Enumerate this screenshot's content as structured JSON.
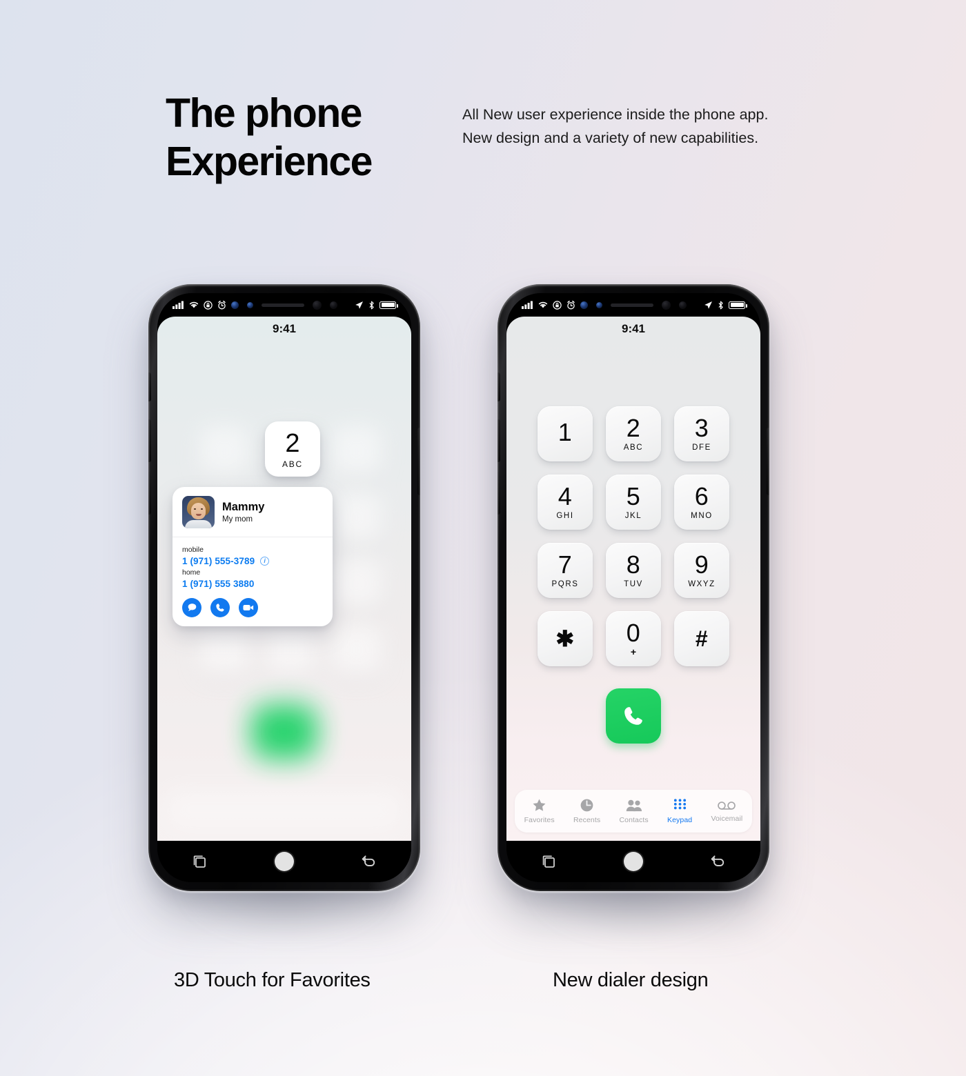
{
  "header": {
    "headline": "The phone Experience",
    "subcopy": "All New user experience inside the phone app. New design and a variety of new capabilities."
  },
  "colors": {
    "accent_blue": "#1279ef",
    "call_green": "#1fd268",
    "tab_active": "#1478f0",
    "tab_inactive": "#a6a6a8",
    "bg_left": "#dde3ee",
    "bg_right": "#f2e6e8"
  },
  "status_bar": {
    "time": "9:41",
    "icons_left": [
      "cellular-signal-icon",
      "wifi-icon",
      "rotation-lock-icon",
      "alarm-icon"
    ],
    "icons_right": [
      "location-icon",
      "bluetooth-icon",
      "battery-icon"
    ]
  },
  "nav_bar": {
    "items": [
      "recents-icon",
      "home-icon",
      "back-icon"
    ]
  },
  "left_phone": {
    "caption": "3D Touch for Favorites",
    "popped_key": {
      "digit": "2",
      "letters": "ABC"
    },
    "contact": {
      "name": "Mammy",
      "relation": "My mom",
      "avatar": "contact-photo",
      "numbers": [
        {
          "label": "mobile",
          "value": "1 (971) 555-3789",
          "has_info": true
        },
        {
          "label": "home",
          "value": "1 (971) 555 3880",
          "has_info": false
        }
      ],
      "actions": [
        "message-icon",
        "call-icon",
        "video-call-icon"
      ]
    }
  },
  "right_phone": {
    "caption": "New dialer design",
    "keypad": [
      {
        "digit": "1",
        "letters": ""
      },
      {
        "digit": "2",
        "letters": "ABC"
      },
      {
        "digit": "3",
        "letters": "DFE"
      },
      {
        "digit": "4",
        "letters": "GHI"
      },
      {
        "digit": "5",
        "letters": "JKL"
      },
      {
        "digit": "6",
        "letters": "MNO"
      },
      {
        "digit": "7",
        "letters": "PQRS"
      },
      {
        "digit": "8",
        "letters": "TUV"
      },
      {
        "digit": "9",
        "letters": "WXYZ"
      },
      {
        "digit": "✱",
        "letters": ""
      },
      {
        "digit": "0",
        "letters": "+"
      },
      {
        "digit": "#",
        "letters": ""
      }
    ],
    "call_button": "call-icon",
    "tabs": [
      {
        "label": "Favorites",
        "icon": "star-icon",
        "active": false
      },
      {
        "label": "Recents",
        "icon": "clock-icon",
        "active": false
      },
      {
        "label": "Contacts",
        "icon": "people-icon",
        "active": false
      },
      {
        "label": "Keypad",
        "icon": "keypad-icon",
        "active": true
      },
      {
        "label": "Voicemail",
        "icon": "voicemail-icon",
        "active": false
      }
    ]
  }
}
